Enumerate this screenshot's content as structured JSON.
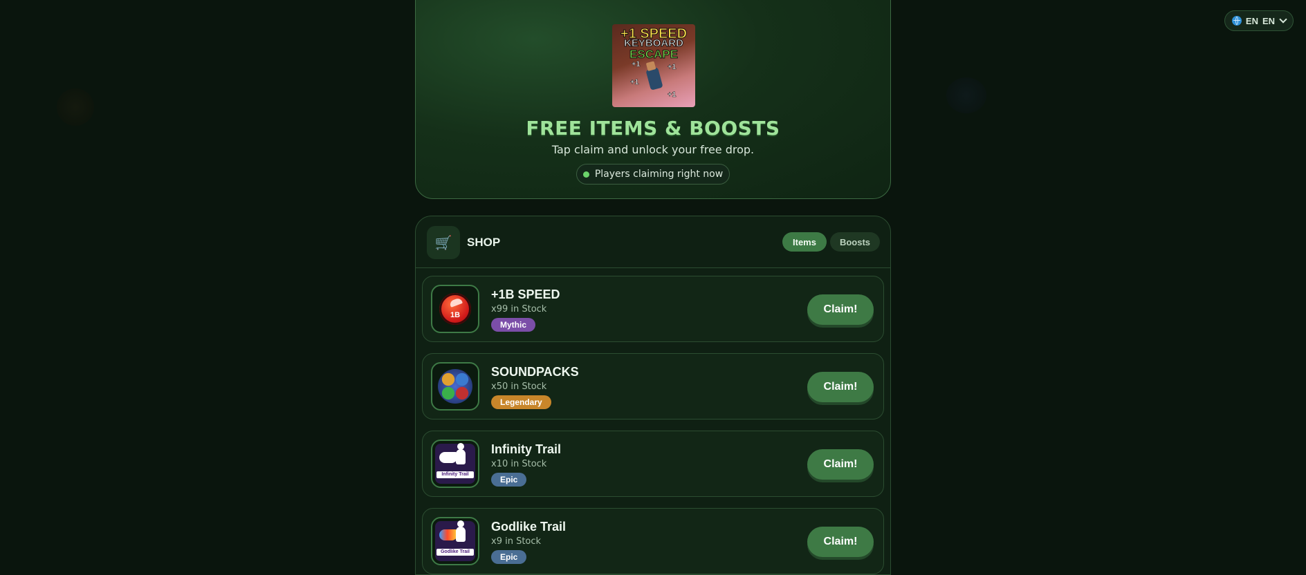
{
  "language": {
    "code": "EN",
    "selected": "EN"
  },
  "hero": {
    "game_image_text": {
      "line1": "+1 SPEED",
      "line2": "KEYBOARD",
      "line3": "ESCAPE",
      "plus": "+1"
    },
    "title": "FREE ITEMS & BOOSTS",
    "subtitle": "Tap claim and unlock your free drop.",
    "live_status": "Players claiming right now"
  },
  "shop": {
    "title": "SHOP",
    "tabs": [
      {
        "label": "Items",
        "active": true
      },
      {
        "label": "Boosts",
        "active": false
      }
    ],
    "items": [
      {
        "name": "+1B SPEED",
        "stock": "x99 in Stock",
        "rarity": "Mythic",
        "rarity_color": "#7b4ea8",
        "icon": "speed-orb-icon",
        "icon_text": "1B",
        "claim_label": "Claim!"
      },
      {
        "name": "SOUNDPACKS",
        "stock": "x50 in Stock",
        "rarity": "Legendary",
        "rarity_color": "#c8862a",
        "icon": "soundpack-icon",
        "claim_label": "Claim!"
      },
      {
        "name": "Infinity Trail",
        "stock": "x10 in Stock",
        "rarity": "Epic",
        "rarity_color": "#4a6e94",
        "icon": "infinity-trail-icon",
        "icon_text": "Infinity Trail",
        "claim_label": "Claim!"
      },
      {
        "name": "Godlike Trail",
        "stock": "x9 in Stock",
        "rarity": "Epic",
        "rarity_color": "#4a6e94",
        "icon": "godlike-trail-icon",
        "icon_text": "Godlike Trail",
        "claim_label": "Claim!"
      }
    ]
  },
  "colors": {
    "background": "#0a150d",
    "accent": "#3e7a45",
    "title_green": "#9fe39a"
  }
}
